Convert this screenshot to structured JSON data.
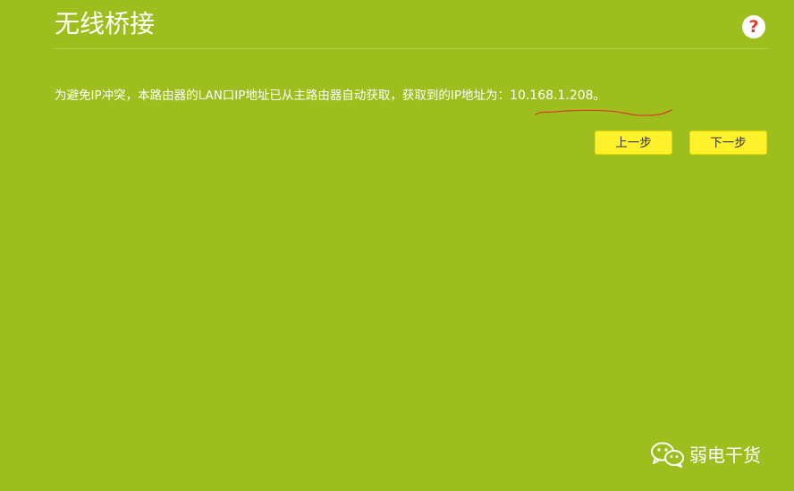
{
  "page": {
    "title": "无线桥接",
    "help_icon": "question-mark-icon",
    "help_glyph": "?"
  },
  "message": {
    "text": "为避免IP冲突，本路由器的LAN口IP地址已从主路由器自动获取，获取到的IP地址为：",
    "ip": "10.168.1.208",
    "suffix": "。"
  },
  "buttons": {
    "prev_label": "上一步",
    "next_label": "下一步"
  },
  "watermark": {
    "icon": "wechat-logo-icon",
    "text": "弱电干货"
  },
  "colors": {
    "background": "#9dbe1c",
    "button": "#fff22a",
    "help_glyph": "#e2392b",
    "annotation": "#d9432a"
  }
}
